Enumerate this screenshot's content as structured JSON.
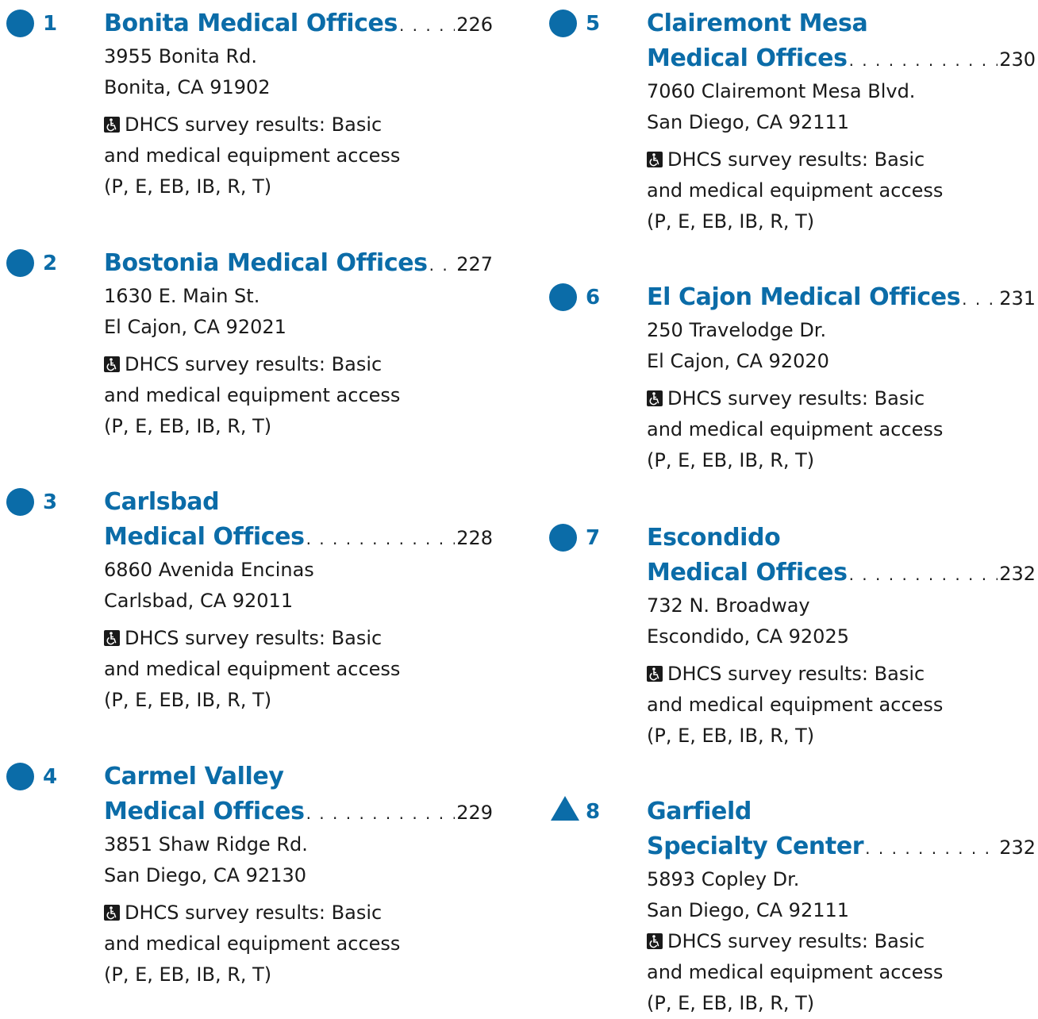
{
  "columns": {
    "left": [
      {
        "number": "1",
        "marker": "circle",
        "title_lines": [],
        "title_last": "Bonita Medical Offices",
        "page": "226",
        "address": [
          "3955 Bonita Rd.",
          "Bonita, CA 91902"
        ],
        "access": [
          "DHCS survey results: Basic",
          "and medical equipment access",
          "(P, E, EB, IB, R, T)"
        ]
      },
      {
        "number": "2",
        "marker": "circle",
        "title_lines": [],
        "title_last": "Bostonia Medical Offices",
        "page": "227",
        "address": [
          "1630 E. Main St.",
          "El Cajon, CA 92021"
        ],
        "access": [
          "DHCS survey results: Basic",
          "and medical equipment access",
          "(P, E, EB, IB, R, T)"
        ]
      },
      {
        "number": "3",
        "marker": "circle",
        "title_lines": [
          "Carlsbad"
        ],
        "title_last": "Medical Offices",
        "page": "228",
        "address": [
          "6860 Avenida Encinas",
          "Carlsbad, CA 92011"
        ],
        "access": [
          "DHCS survey results: Basic",
          "and medical equipment access",
          "(P, E, EB, IB, R, T)"
        ]
      },
      {
        "number": "4",
        "marker": "circle",
        "title_lines": [
          "Carmel Valley"
        ],
        "title_last": "Medical Offices",
        "page": "229",
        "address": [
          "3851 Shaw Ridge Rd.",
          "San Diego, CA 92130"
        ],
        "access": [
          "DHCS survey results: Basic",
          "and medical equipment access",
          "(P, E, EB, IB, R, T)"
        ]
      }
    ],
    "right": [
      {
        "number": "5",
        "marker": "circle",
        "title_lines": [
          "Clairemont Mesa"
        ],
        "title_last": "Medical Offices",
        "page": "230",
        "address": [
          "7060 Clairemont Mesa Blvd.",
          "San Diego, CA 92111"
        ],
        "access": [
          "DHCS survey results: Basic",
          "and medical equipment access",
          "(P, E, EB, IB, R, T)"
        ]
      },
      {
        "number": "6",
        "marker": "circle",
        "title_lines": [],
        "title_last": "El Cajon Medical Offices",
        "page": "231",
        "address": [
          "250 Travelodge Dr.",
          "El Cajon, CA 92020"
        ],
        "access": [
          "DHCS survey results: Basic",
          "and medical equipment access",
          "(P, E, EB, IB, R, T)"
        ]
      },
      {
        "number": "7",
        "marker": "circle",
        "title_lines": [
          "Escondido"
        ],
        "title_last": "Medical Offices",
        "page": "232",
        "address": [
          "732 N. Broadway",
          "Escondido, CA 92025"
        ],
        "access": [
          "DHCS survey results: Basic",
          "and medical equipment access",
          "(P, E, EB, IB, R, T)"
        ]
      },
      {
        "number": "8",
        "marker": "triangle",
        "title_lines": [
          "Garfield"
        ],
        "title_last": "Specialty Center",
        "page": "232",
        "address": [
          "5893 Copley Dr.",
          "San Diego, CA 92111"
        ],
        "access": [
          "DHCS survey results: Basic",
          "and medical equipment access",
          "(P, E, EB, IB, R, T)"
        ]
      }
    ]
  },
  "icons": {
    "circle_marker": "facility-circle-icon",
    "triangle_marker": "facility-triangle-icon",
    "access": "wheelchair-icon"
  },
  "colors": {
    "accent": "#0b6ca8",
    "text": "#1a1a1a"
  }
}
